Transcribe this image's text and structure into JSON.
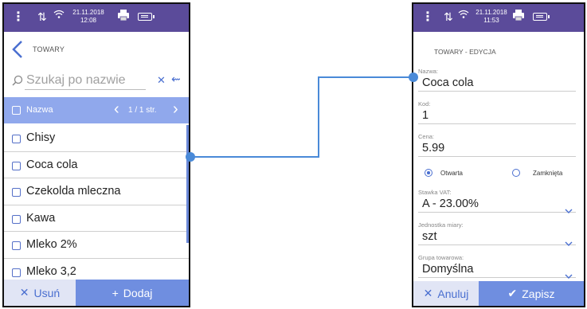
{
  "left_screen": {
    "status_bar": {
      "date": "21.11.2018",
      "time": "12:08"
    },
    "title": "TOWARY",
    "search": {
      "placeholder": "Szukaj po nazwie"
    },
    "list_header": {
      "column": "Nazwa",
      "page": "1 / 1 str."
    },
    "items": [
      {
        "label": "Chisy"
      },
      {
        "label": "Coca cola"
      },
      {
        "label": "Czekolda mleczna"
      },
      {
        "label": "Kawa"
      },
      {
        "label": "Mleko 2%"
      },
      {
        "label": "Mleko 3,2"
      }
    ],
    "buttons": {
      "delete": "Usuń",
      "add": "Dodaj"
    }
  },
  "right_screen": {
    "status_bar": {
      "date": "21.11.2018",
      "time": "11:53"
    },
    "title": "TOWARY - EDYCJA",
    "fields": {
      "name": {
        "label": "Nazwa:",
        "value": "Coca cola"
      },
      "code": {
        "label": "Kod:",
        "value": "1"
      },
      "price": {
        "label": "Cena:",
        "value": "5.99"
      },
      "price_type": {
        "open": "Otwarta",
        "closed": "Zamknięta",
        "selected": "Otwarta"
      },
      "vat": {
        "label": "Stawka VAT:",
        "value": "A - 23.00%"
      },
      "unit": {
        "label": "Jednostka miary:",
        "value": "szt"
      },
      "group": {
        "label": "Grupa towarowa:",
        "value": "Domyślna"
      }
    },
    "buttons": {
      "cancel": "Anuluj",
      "save": "Zapisz"
    }
  },
  "colors": {
    "status_bar": "#5b4b9a",
    "accent": "#4a6fd0",
    "header_highlight": "#90a8ec",
    "primary_button": "#6f8ee0",
    "secondary_button": "#e1e5f5",
    "connector": "#4a8ad8"
  },
  "icons": [
    "kebab-menu-icon",
    "sort-arrows-icon",
    "wifi-icon",
    "printer-icon",
    "battery-icon",
    "back-chevron-icon",
    "search-icon",
    "clear-icon",
    "swap-icon",
    "chevron-down-icon",
    "checkmark-icon",
    "close-icon",
    "plus-icon"
  ]
}
